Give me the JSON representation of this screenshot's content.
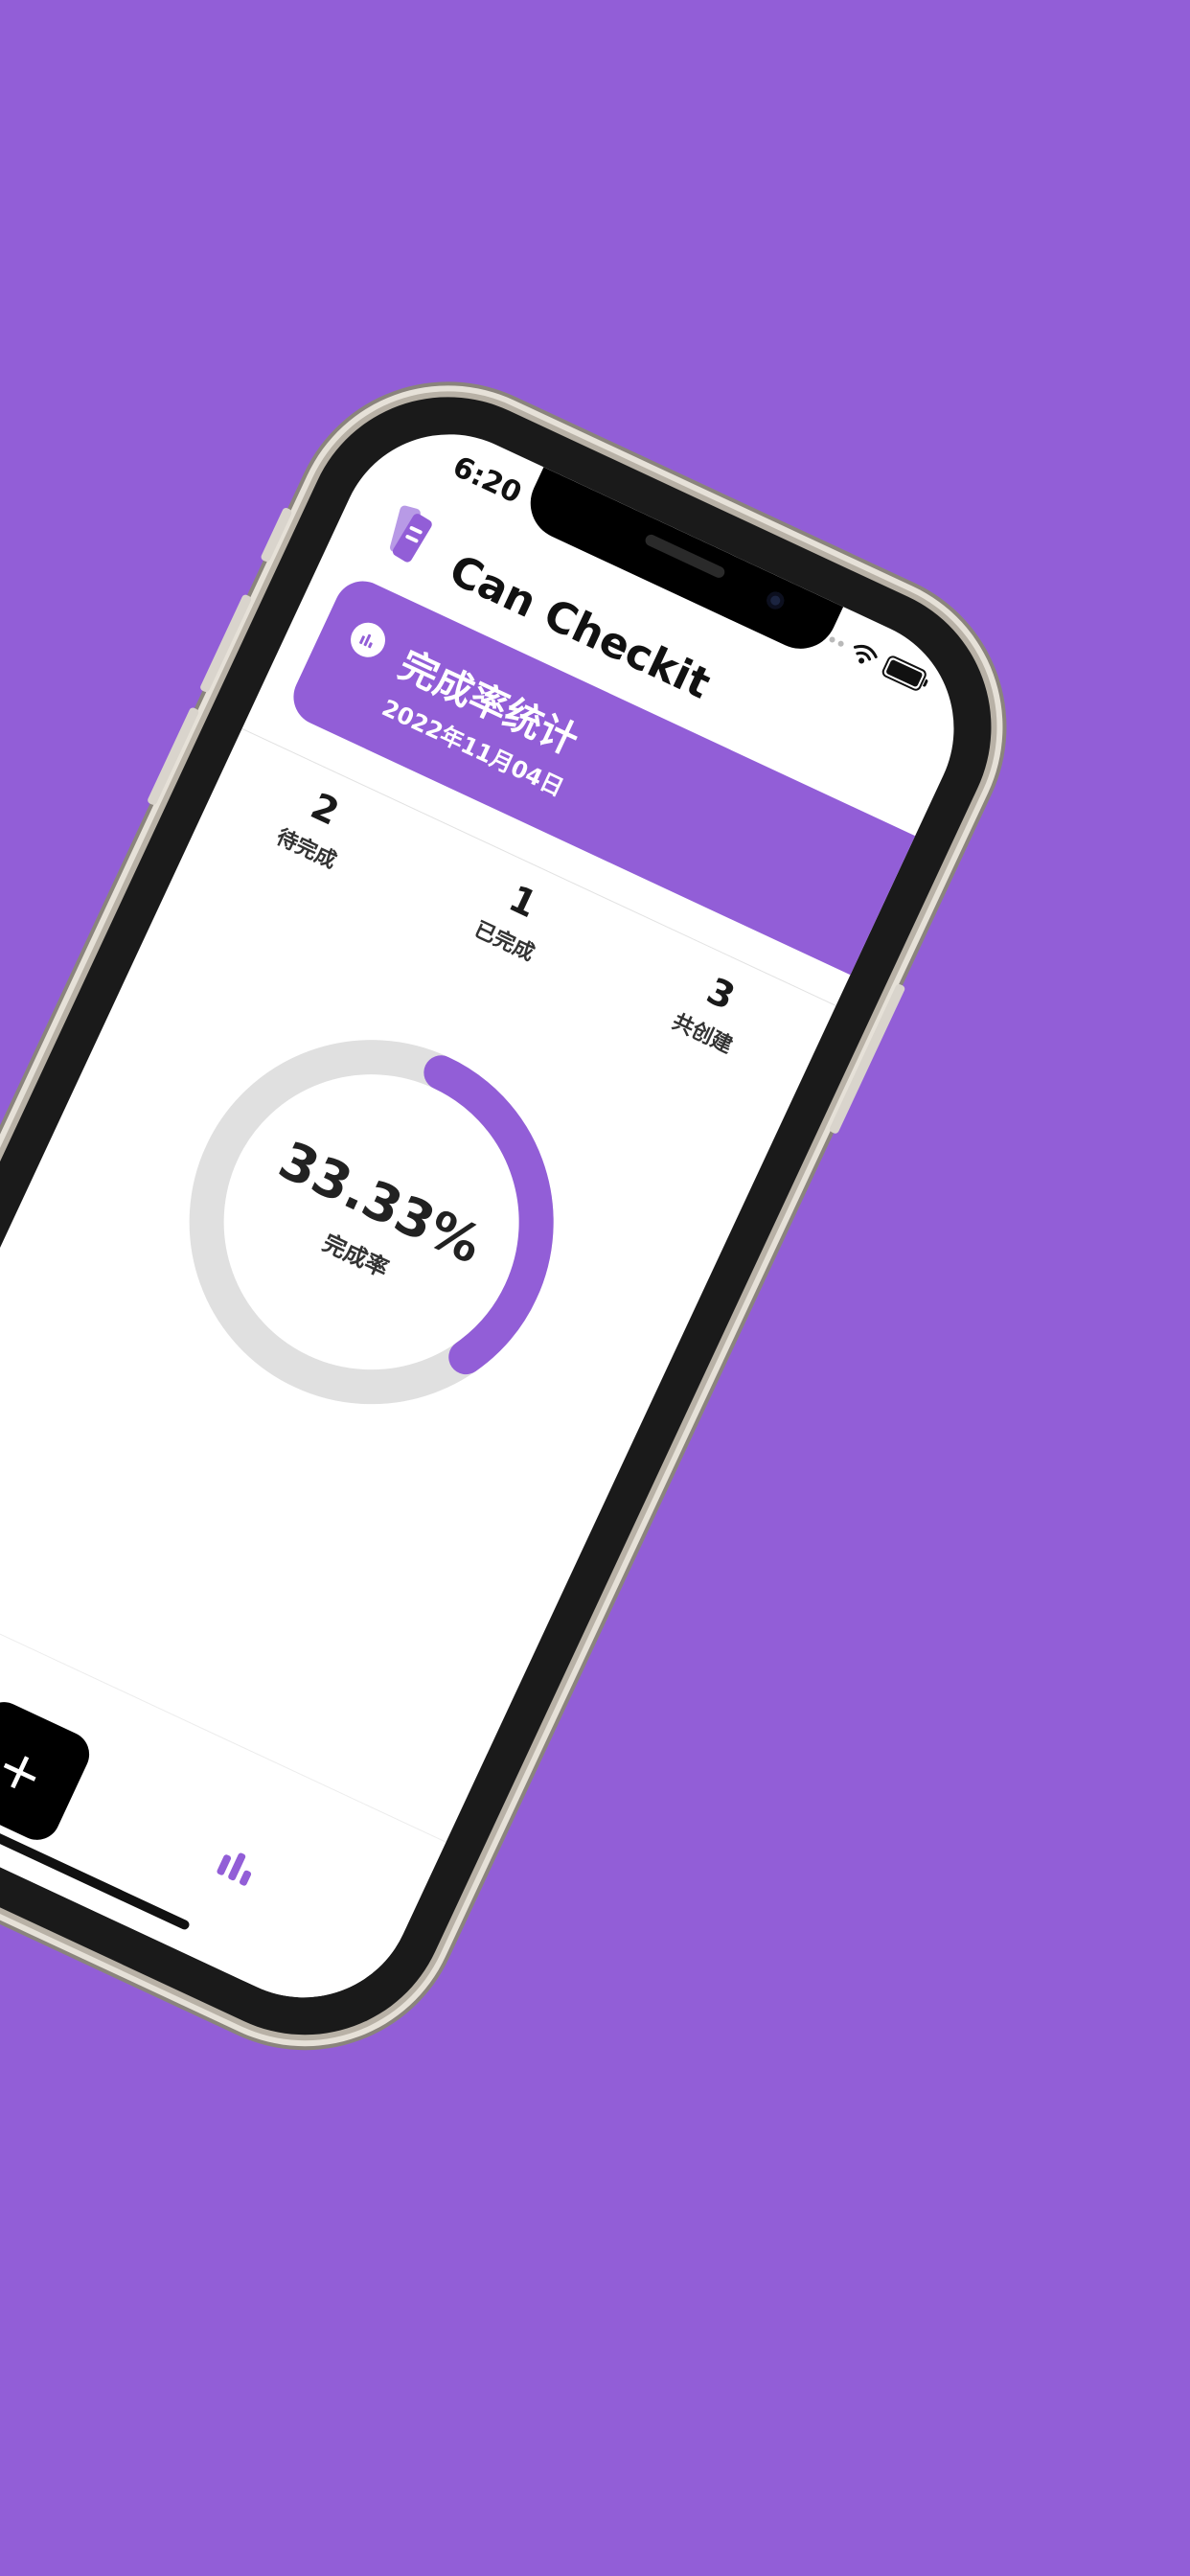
{
  "app": {
    "title": "Can Checkit"
  },
  "status_bar": {
    "time": "6:20"
  },
  "banner": {
    "title": "完成率统计",
    "date": "2022年11月04日",
    "icon": "bar-chart-icon"
  },
  "stats": [
    {
      "value": "2",
      "label": "待完成"
    },
    {
      "value": "1",
      "label": "已完成"
    },
    {
      "value": "3",
      "label": "共创建"
    }
  ],
  "completion": {
    "value_text": "33.33%",
    "label": "完成率",
    "fraction": 0.3333
  },
  "tabbar": {
    "add_label": "+"
  },
  "colors": {
    "accent": "#925ed7",
    "track": "#e0e0e0",
    "background": "#925ed7"
  }
}
